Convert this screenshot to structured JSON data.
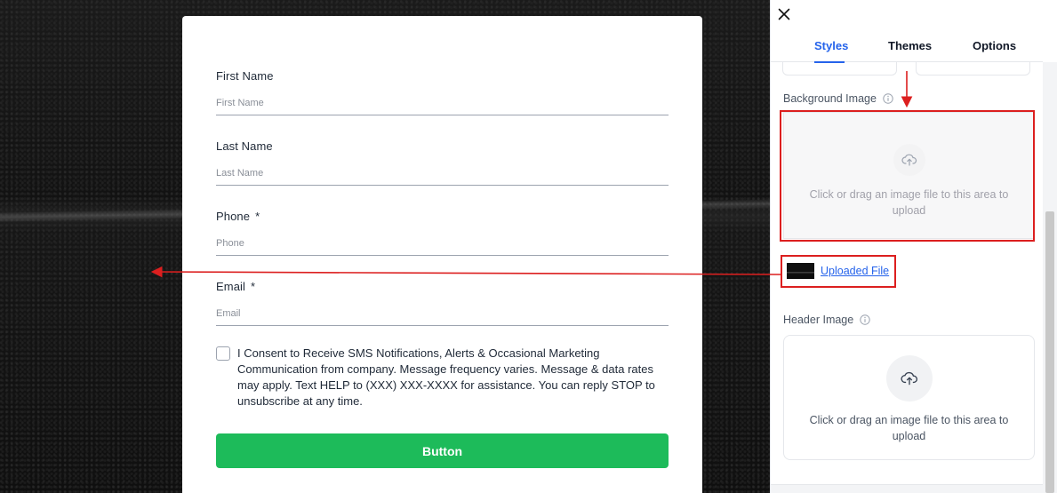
{
  "form": {
    "fields": [
      {
        "label": "First Name",
        "placeholder": "First Name",
        "required": false
      },
      {
        "label": "Last Name",
        "placeholder": "Last Name",
        "required": false
      },
      {
        "label": "Phone",
        "placeholder": "Phone",
        "required": true
      },
      {
        "label": "Email",
        "placeholder": "Email",
        "required": true
      }
    ],
    "required_marker": "*",
    "consent_text": "I Consent to Receive SMS Notifications, Alerts & Occasional Marketing Communication from company. Message frequency varies. Message & data rates may apply. Text HELP to (XXX) XXX-XXXX for assistance. You can reply STOP to unsubscribe at any time.",
    "button_label": "Button"
  },
  "panel": {
    "tabs": [
      {
        "label": "Styles",
        "active": true
      },
      {
        "label": "Themes",
        "active": false
      },
      {
        "label": "Options",
        "active": false
      }
    ],
    "background_image": {
      "label": "Background Image",
      "dropzone_text": "Click or drag an image file to this area to upload",
      "uploaded_link": "Uploaded File"
    },
    "header_image": {
      "label": "Header Image",
      "dropzone_text": "Click or drag an image file to this area to upload"
    }
  },
  "colors": {
    "accent": "#2563eb",
    "button": "#1dbb5a",
    "annotation": "#dc1f1f"
  },
  "icons": [
    "close-icon",
    "info-icon",
    "upload-cloud-icon"
  ]
}
